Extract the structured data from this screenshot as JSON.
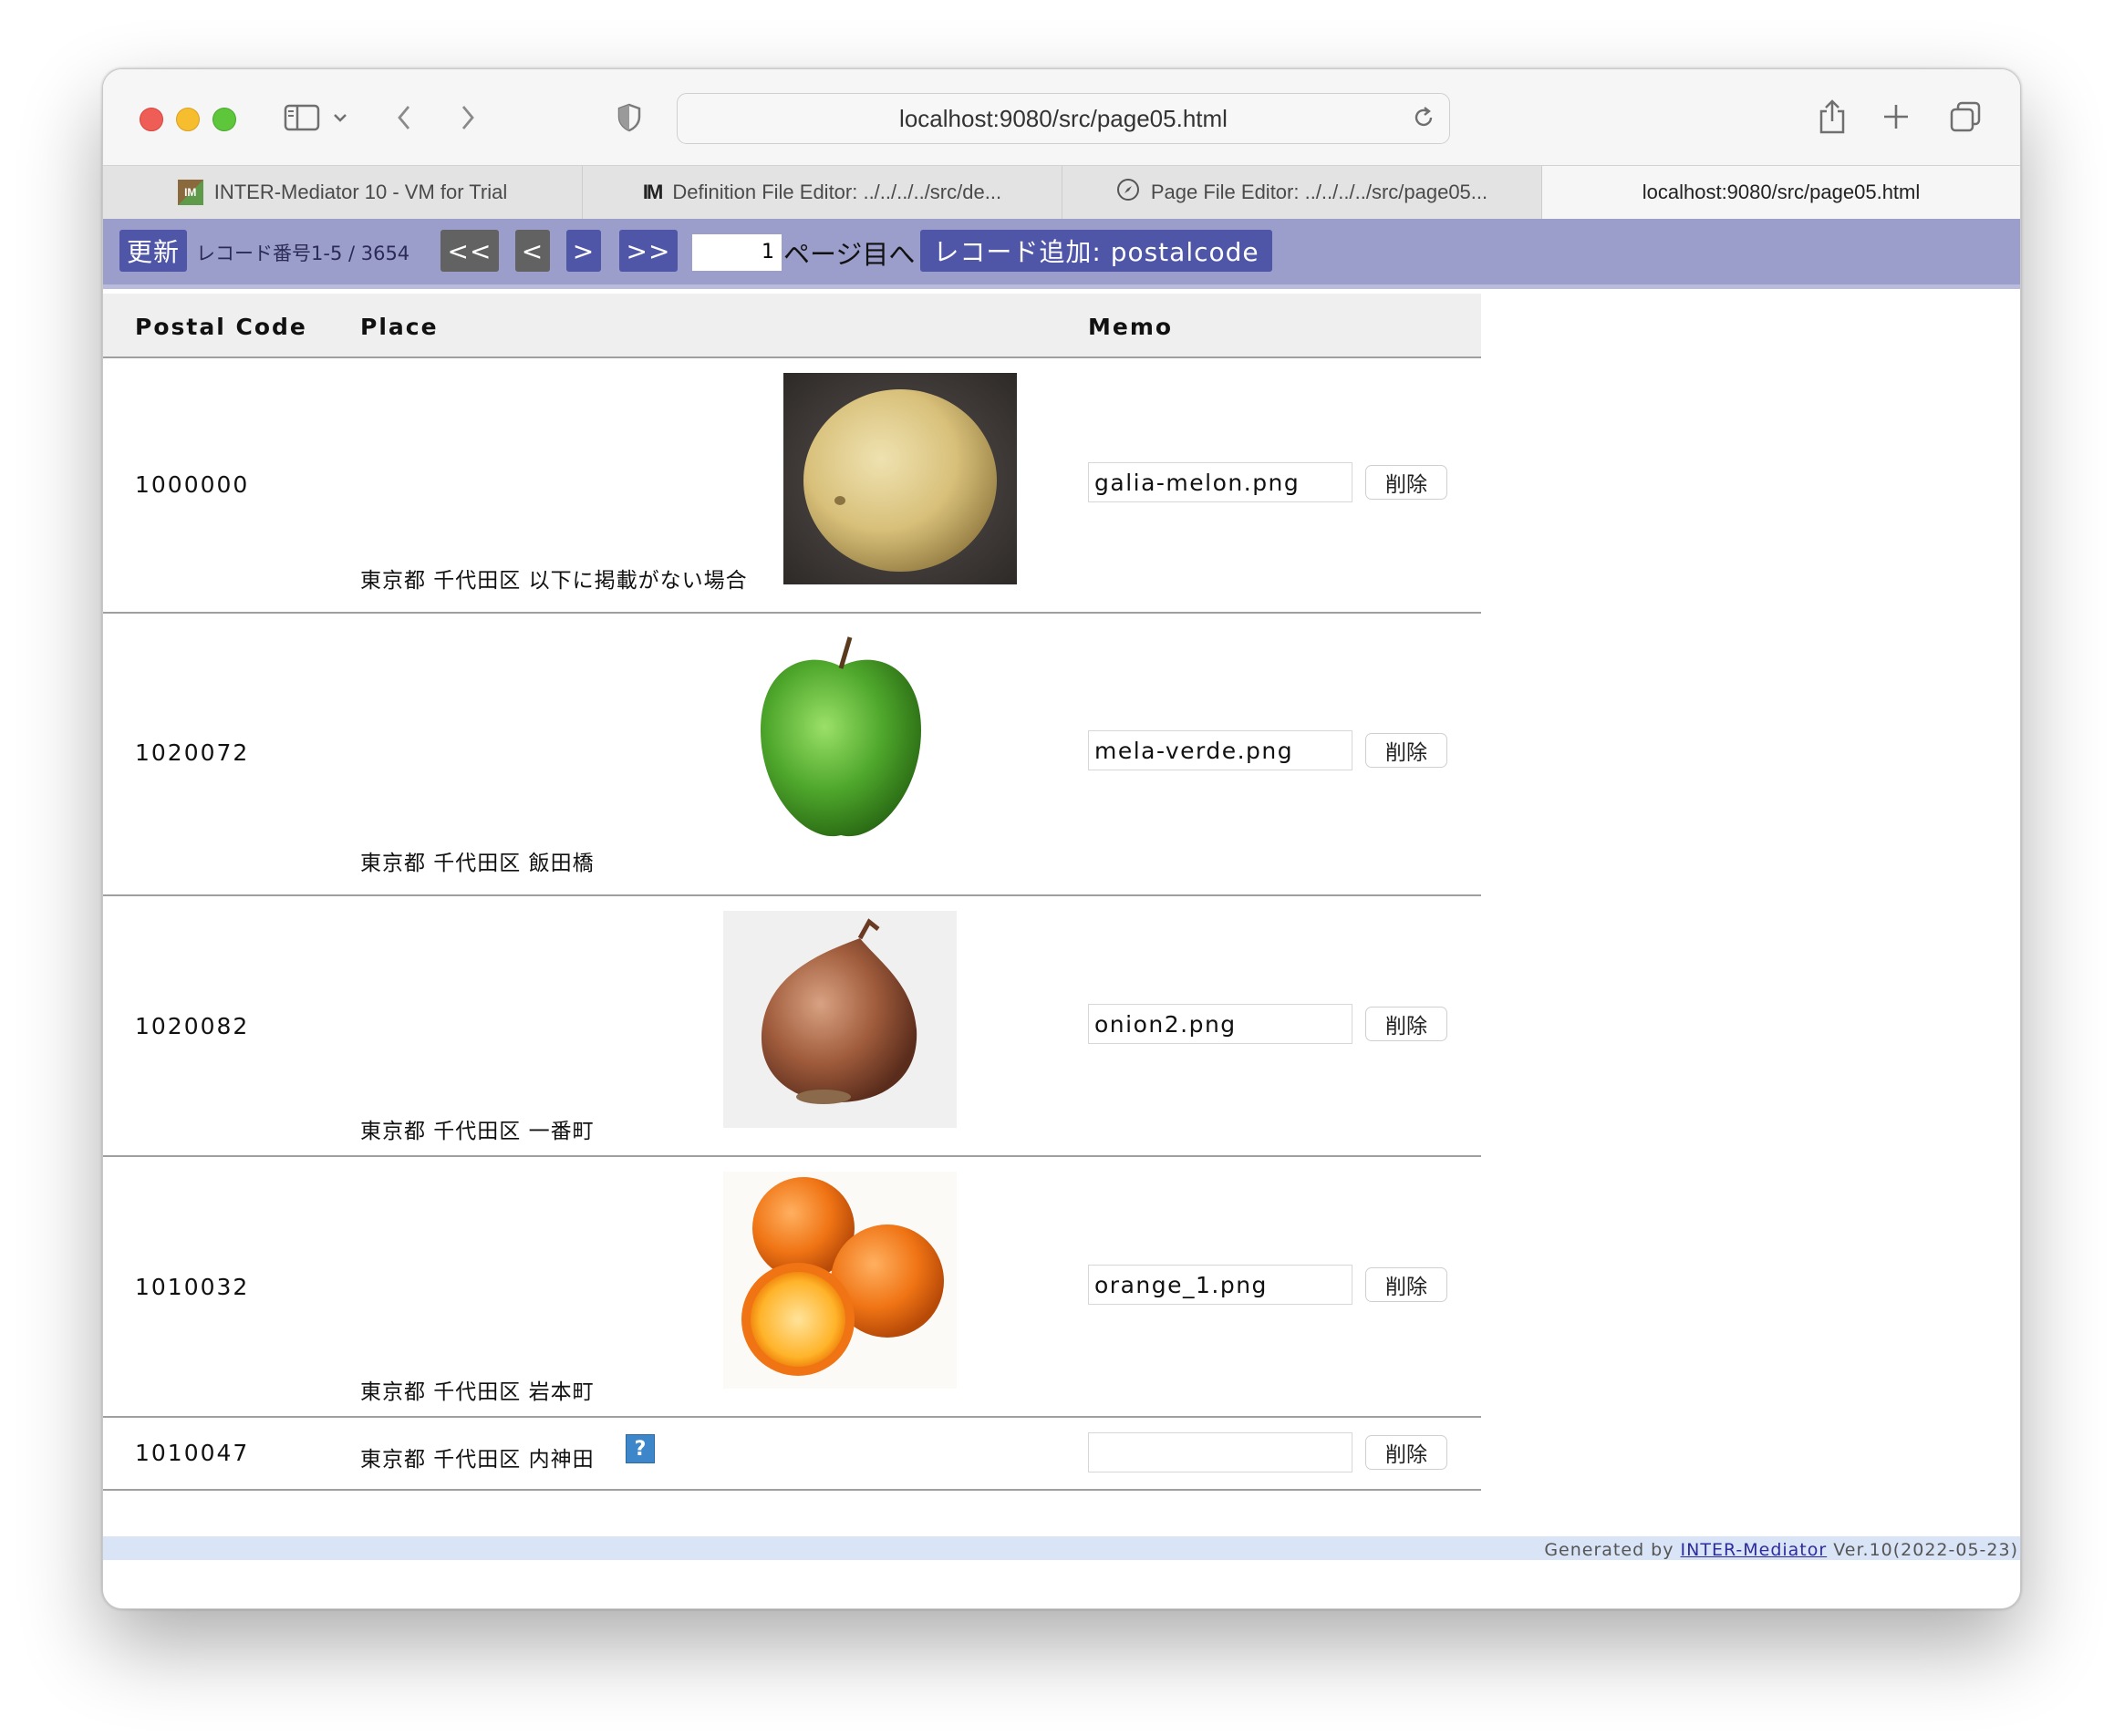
{
  "browser": {
    "url": "localhost:9080/src/page05.html",
    "tabs": [
      {
        "label": "INTER-Mediator 10 - VM for Trial",
        "icon": "im-favicon-icon"
      },
      {
        "label": "Definition File Editor: ../../../../src/de...",
        "icon": "definition-file-icon"
      },
      {
        "label": "Page File Editor: ../../../../src/page05...",
        "icon": "compass-icon"
      },
      {
        "label": "localhost:9080/src/page05.html",
        "icon": ""
      }
    ]
  },
  "navbar": {
    "refresh_label": "更新",
    "record_info": "レコード番号1-5 / 3654",
    "first_label": "<<",
    "prev_label": "<",
    "next_label": ">",
    "last_label": ">>",
    "page_value": "1",
    "goto_label": "ページ目へ",
    "add_label": "レコード追加: postalcode"
  },
  "table": {
    "headers": {
      "code": "Postal Code",
      "place": "Place",
      "memo": "Memo"
    },
    "rows": [
      {
        "code": "1000000",
        "place": "東京都 千代田区 以下に掲載がない場合",
        "image": "galia-melon",
        "memo": "galia-melon.png",
        "delete": "削除"
      },
      {
        "code": "1020072",
        "place": "東京都 千代田区 飯田橋",
        "image": "green-apple",
        "memo": "mela-verde.png",
        "delete": "削除"
      },
      {
        "code": "1020082",
        "place": "東京都 千代田区 一番町",
        "image": "onion",
        "memo": "onion2.png",
        "delete": "削除"
      },
      {
        "code": "1010032",
        "place": "東京都 千代田区 岩本町",
        "image": "oranges",
        "memo": "orange_1.png",
        "delete": "削除"
      },
      {
        "code": "1010047",
        "place": "東京都 千代田区 内神田",
        "image": "missing-image-icon",
        "memo": "",
        "delete": "削除"
      }
    ]
  },
  "footer": {
    "prefix": "Generated by",
    "link": "INTER-Mediator",
    "suffix": "Ver.10(2022-05-23)"
  },
  "colors": {
    "navbar_bg": "#9b9dcb",
    "button_bg": "#4f56a8",
    "footer_bg": "#d9e4f7"
  }
}
